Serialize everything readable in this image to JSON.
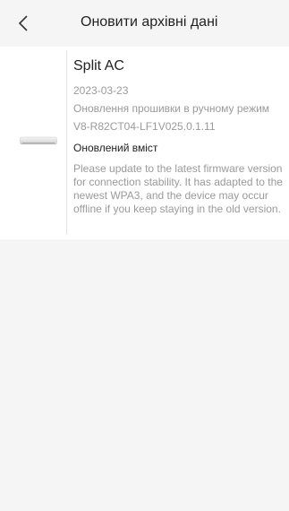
{
  "header": {
    "back_icon": "chevron-left-icon",
    "title": "Оновити архівні дані"
  },
  "record": {
    "thumbnail_icon": "air-conditioner-icon",
    "device_name": "Split AC",
    "date": "2023-03-23",
    "update_type": "Оновлення прошивки в ручному режим",
    "firmware_version": "V8-R82CT04-LF1V025.0.1.11",
    "section_title": "Оновлений вміст",
    "description": "Please update to the latest firmware version for connection stability. It has adapted to the newest WPA3, and the device may occur offline if you keep staying in the old version."
  }
}
